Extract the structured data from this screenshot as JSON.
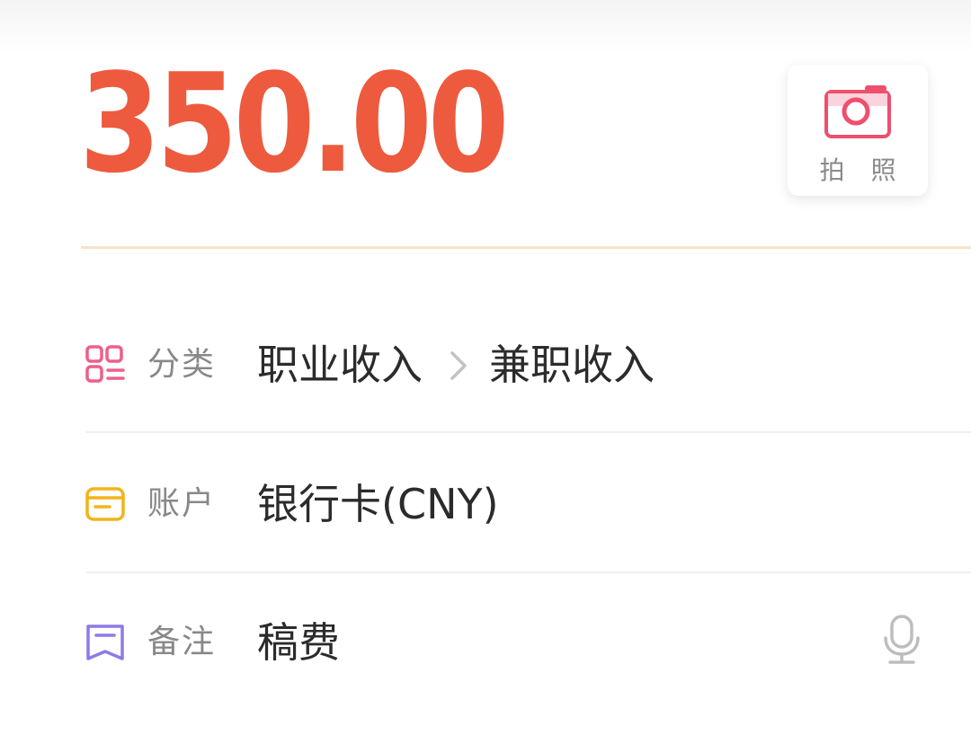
{
  "amount": "350.00",
  "colors": {
    "amount": "#ee5a3e",
    "camera_icon": "#ee4f6d",
    "category_icon": "#ee5f8a",
    "account_icon": "#f2b418",
    "note_icon": "#8f7ae6",
    "divider_accent": "#f6e4c6"
  },
  "photo_button": {
    "icon": "camera-icon",
    "label": "拍 照"
  },
  "fields": {
    "category": {
      "icon": "category-grid-icon",
      "label": "分类",
      "value_parent": "职业收入",
      "separator_icon": "chevron-right-icon",
      "value_child": "兼职收入"
    },
    "account": {
      "icon": "card-icon",
      "label": "账户",
      "value": "银行卡(CNY)"
    },
    "note": {
      "icon": "bookmark-icon",
      "label": "备注",
      "value": "稿费",
      "action_icon": "microphone-icon"
    }
  }
}
